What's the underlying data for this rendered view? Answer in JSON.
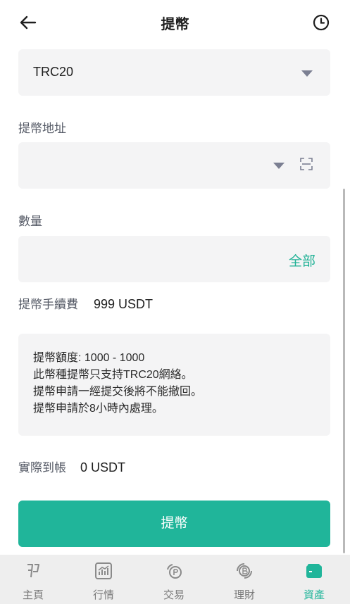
{
  "header": {
    "title": "提幣"
  },
  "network": {
    "value": "TRC20"
  },
  "address": {
    "label": "提幣地址",
    "value": ""
  },
  "amount": {
    "label": "數量",
    "value": "",
    "all_label": "全部"
  },
  "fee": {
    "label": "提幣手續費",
    "value": "999 USDT"
  },
  "notice": {
    "lines": [
      "提幣額度: 1000 - 1000",
      "此幣種提幣只支持TRC20網絡。",
      "提幣申請一經提交後將不能撤回。",
      "提幣申請於8小時內處理。"
    ]
  },
  "received": {
    "label": "實際到帳",
    "value": "0 USDT"
  },
  "submit": {
    "label": "提幣"
  },
  "tabbar": {
    "tabs": [
      {
        "label": "主頁",
        "icon": "home-icon"
      },
      {
        "label": "行情",
        "icon": "market-chart-icon"
      },
      {
        "label": "交易",
        "icon": "trade-icon"
      },
      {
        "label": "理財",
        "icon": "finance-icon"
      },
      {
        "label": "資產",
        "icon": "wallet-icon"
      }
    ],
    "active_index": 4
  },
  "colors": {
    "accent": "#20b59a",
    "field_bg": "#f4f4f5"
  }
}
